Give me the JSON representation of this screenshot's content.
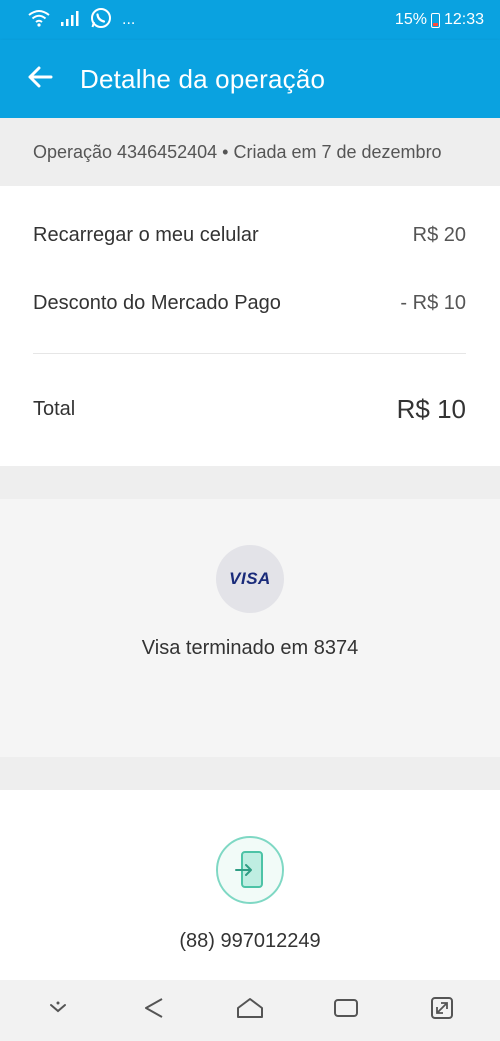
{
  "status_bar": {
    "battery": "15%",
    "time": "12:33",
    "overflow": "..."
  },
  "header": {
    "title": "Detalhe da operação",
    "back_icon": "arrow-back-icon"
  },
  "operation": {
    "info": "Operação 4346452404 • Criada em 7 de dezembro"
  },
  "summary": {
    "items": [
      {
        "label": "Recarregar o meu celular",
        "value": "R$ 20"
      },
      {
        "label": "Desconto do Mercado Pago",
        "value": "- R$ 10"
      }
    ],
    "total_label": "Total",
    "total_value": "R$ 10"
  },
  "payment": {
    "brand": "VISA",
    "card_text": "Visa terminado em 8374"
  },
  "phone": {
    "number": "(88) 997012249",
    "icon": "phone-recharge-icon"
  },
  "colors": {
    "primary": "#0aa2e0",
    "accent_green": "#7fd8c4",
    "visa_blue": "#1a2b7a"
  }
}
